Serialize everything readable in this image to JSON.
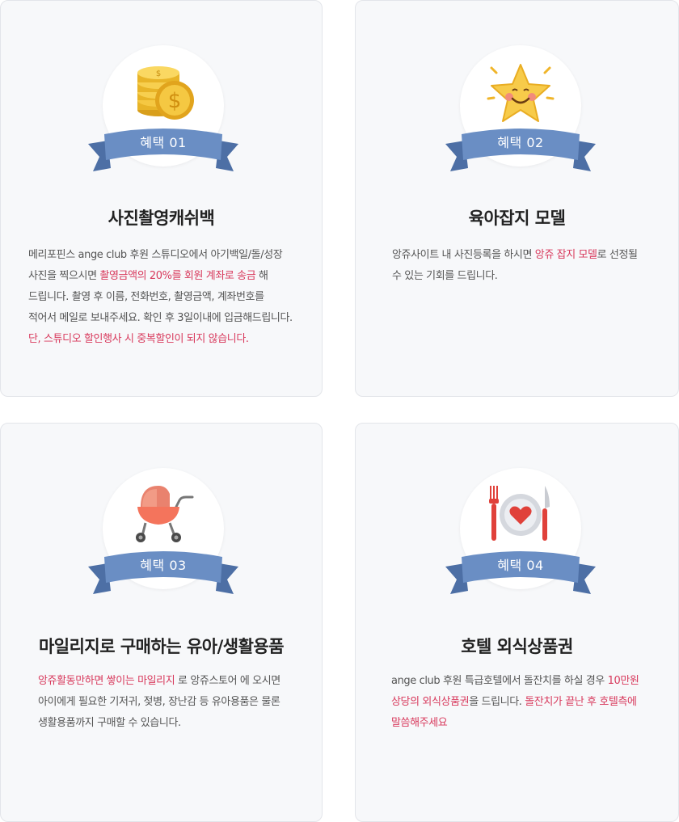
{
  "benefits": [
    {
      "badge": "혜택 01",
      "icon": "coins-icon",
      "title": "사진촬영캐쉬백",
      "lines": [
        [
          {
            "t": "메리포핀스 ange club 후원 스튜디오에서 아기백일/돌/성장"
          }
        ],
        [
          {
            "t": "사진을 찍으시면 "
          },
          {
            "t": "촬영금액의 20%를 회원 계좌로 송금",
            "h": true
          },
          {
            "t": " 해"
          }
        ],
        [
          {
            "t": "드립니다. 촬영 후 이름, 전화번호, 촬영금액, 계좌번호를"
          }
        ],
        [
          {
            "t": "적어서 메일로 보내주세요. 확인 후 3일이내에 입금해드립니다."
          }
        ],
        [
          {
            "t": "단, 스튜디오 할인행사 시 중복할인이 되지 않습니다.",
            "h": true
          }
        ]
      ]
    },
    {
      "badge": "혜택 02",
      "icon": "star-face-icon",
      "title": "육아잡지 모델",
      "lines": [
        [
          {
            "t": "앙쥬사이트 내 사진등록을 하시면 "
          },
          {
            "t": "앙쥬 잡지 모델",
            "h": true
          },
          {
            "t": "로 선정될"
          }
        ],
        [
          {
            "t": "수 있는 기회를 드립니다."
          }
        ]
      ]
    },
    {
      "badge": "혜택 03",
      "icon": "stroller-icon",
      "title": "마일리지로 구매하는 유아/생활용품",
      "lines": [
        [
          {
            "t": "앙쥬활동만하면 쌓이는 마일리지",
            "h": true
          },
          {
            "t": " 로 앙쥬스토어 에 오시면"
          }
        ],
        [
          {
            "t": " 아이에게 필요한 기저귀, 젖병, 장난감 등 유아용품은 물론"
          }
        ],
        [
          {
            "t": "생활용품까지  구매할 수 있습니다."
          }
        ]
      ]
    },
    {
      "badge": "혜택 04",
      "icon": "dining-plate-icon",
      "title": "호텔 외식상품권",
      "lines": [
        [
          {
            "t": "ange club 후원 특급호텔에서 돌잔치를 하실 경우 "
          },
          {
            "t": "10만원",
            "h": true
          }
        ],
        [
          {
            "t": "상당의  외식상품권",
            "h": true
          },
          {
            "t": "을 드립니다. "
          },
          {
            "t": "돌잔치가 끝난 후 호텔측에",
            "h": true
          }
        ],
        [
          {
            "t": "말씀해주세요",
            "h": true
          }
        ]
      ]
    }
  ],
  "colors": {
    "ribbon": "#6a8ec4",
    "ribbon_dark": "#4d6fa5",
    "highlight": "#d8395c"
  }
}
